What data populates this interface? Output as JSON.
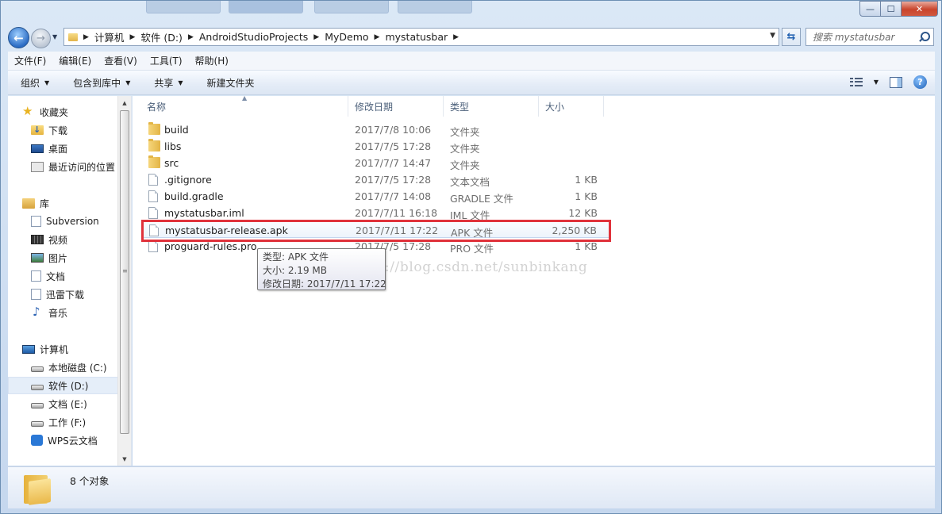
{
  "window": {
    "controls": {
      "minimize": "—",
      "maximize": "☐",
      "close": "✕"
    }
  },
  "navigation": {
    "back_glyph": "←",
    "forward_glyph": "→",
    "history_glyph": "▼",
    "breadcrumbs": [
      "计算机",
      "软件 (D:)",
      "AndroidStudioProjects",
      "MyDemo",
      "mystatusbar"
    ],
    "refresh_glyph": "⇆",
    "search_placeholder": "搜索 mystatusbar"
  },
  "menubar": {
    "items": [
      "文件(F)",
      "编辑(E)",
      "查看(V)",
      "工具(T)",
      "帮助(H)"
    ]
  },
  "toolbar": {
    "organize": "组织",
    "include_in_library": "包含到库中",
    "share": "共享",
    "new_folder": "新建文件夹",
    "help": "?"
  },
  "sidebar": {
    "favorites": {
      "label": "收藏夹",
      "items": [
        "下载",
        "桌面",
        "最近访问的位置"
      ]
    },
    "libraries": {
      "label": "库",
      "items": [
        "Subversion",
        "视频",
        "图片",
        "文档",
        "迅雷下载",
        "音乐"
      ]
    },
    "computer": {
      "label": "计算机",
      "items": [
        "本地磁盘 (C:)",
        "软件 (D:)",
        "文档 (E:)",
        "工作 (F:)",
        "WPS云文档"
      ]
    },
    "selected": "软件 (D:)"
  },
  "columns": {
    "name": "名称",
    "modified": "修改日期",
    "type": "类型",
    "size": "大小"
  },
  "files": [
    {
      "name": "build",
      "modified": "2017/7/8 10:06",
      "type": "文件夹",
      "size": "",
      "icon": "folder-icon"
    },
    {
      "name": "libs",
      "modified": "2017/7/5 17:28",
      "type": "文件夹",
      "size": "",
      "icon": "folder-icon"
    },
    {
      "name": "src",
      "modified": "2017/7/7 14:47",
      "type": "文件夹",
      "size": "",
      "icon": "folder-icon"
    },
    {
      "name": ".gitignore",
      "modified": "2017/7/5 17:28",
      "type": "文本文档",
      "size": "1 KB",
      "icon": "file-icon"
    },
    {
      "name": "build.gradle",
      "modified": "2017/7/7 14:08",
      "type": "GRADLE 文件",
      "size": "1 KB",
      "icon": "file-icon"
    },
    {
      "name": "mystatusbar.iml",
      "modified": "2017/7/11 16:18",
      "type": "IML 文件",
      "size": "12 KB",
      "icon": "file-icon"
    },
    {
      "name": "mystatusbar-release.apk",
      "modified": "2017/7/11 17:22",
      "type": "APK 文件",
      "size": "2,250 KB",
      "icon": "file-icon"
    },
    {
      "name": "proguard-rules.pro",
      "modified": "2017/7/5 17:28",
      "type": "PRO 文件",
      "size": "1 KB",
      "icon": "file-icon"
    }
  ],
  "hovered_file": "mystatusbar-release.apk",
  "tooltip": {
    "line1": "类型: APK 文件",
    "line2": "大小: 2.19 MB",
    "line3": "修改日期: 2017/7/11 17:22"
  },
  "watermark": "http://blog.csdn.net/sunbinkang",
  "status": {
    "item_count": "8 个对象"
  },
  "colors": {
    "highlight_border": "#e0323b",
    "accent": "#2c6cc4"
  }
}
